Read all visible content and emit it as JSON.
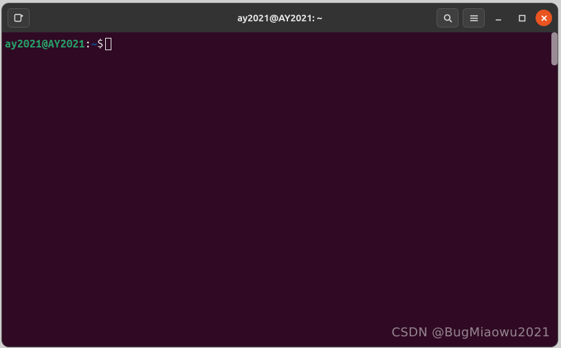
{
  "window": {
    "title": "ay2021@AY2021: ~"
  },
  "prompt": {
    "user_host": "ay2021@AY2021",
    "separator": ":",
    "cwd": "~",
    "symbol": "$"
  },
  "watermark": "CSDN @BugMiaowu2021",
  "icons": {
    "new_tab": "new-tab-icon",
    "search": "search-icon",
    "menu": "menu-icon",
    "minimize": "minimize-icon",
    "maximize": "maximize-icon",
    "close": "close-icon"
  }
}
